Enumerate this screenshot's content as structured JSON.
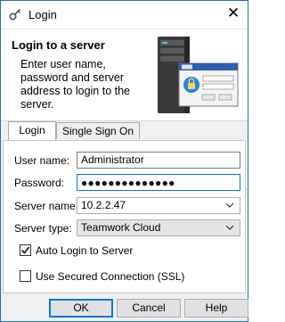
{
  "window": {
    "title": "Login",
    "icons": [
      "key-app-icon",
      "close-icon"
    ]
  },
  "banner": {
    "title": "Login to a server",
    "text": "Enter user name, password and server address to login to the server.",
    "art_icon": "server-login-illustration"
  },
  "tabs": [
    {
      "label": "Login",
      "active": true
    },
    {
      "label": "Single Sign On",
      "active": false
    }
  ],
  "form": {
    "user_name_label": "User name:",
    "user_name_value": "Administrator",
    "password_label": "Password:",
    "password_masked": "●●●●●●●●●●●●●●",
    "server_name_label": "Server name:",
    "server_name_value": "10.2.2.47",
    "server_type_label": "Server type:",
    "server_type_value": "Teamwork Cloud",
    "auto_login_label": "Auto Login to Server",
    "auto_login_checked": true,
    "ssl_label": "Use Secured Connection (SSL)",
    "ssl_checked": false
  },
  "buttons": {
    "ok": "OK",
    "cancel": "Cancel",
    "help": "Help"
  },
  "colors": {
    "focus": "#0078d7",
    "window_border": "#1f6fbf"
  }
}
